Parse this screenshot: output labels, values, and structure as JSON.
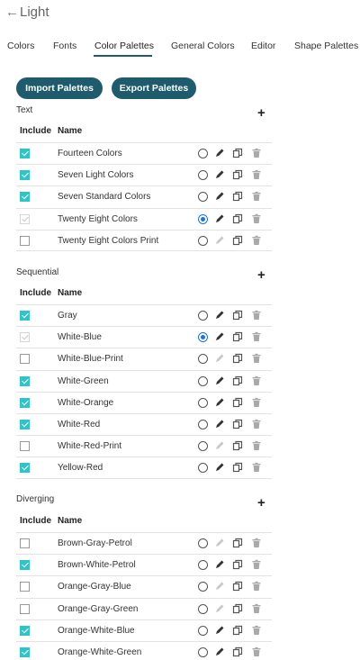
{
  "header": {
    "back_icon": "arrow-left-icon",
    "title": "Light"
  },
  "tabs": [
    {
      "label": "Colors",
      "active": false
    },
    {
      "label": "Fonts",
      "active": false
    },
    {
      "label": "Color Palettes",
      "active": true
    },
    {
      "label": "General Colors",
      "active": false
    },
    {
      "label": "Editor",
      "active": false
    },
    {
      "label": "Shape Palettes",
      "active": false
    }
  ],
  "actions": {
    "import_label": "Import Palettes",
    "export_label": "Export Palettes"
  },
  "columns": {
    "include": "Include",
    "name": "Name"
  },
  "colors": {
    "accent": "#1e5b6c",
    "check": "#2ec4c9",
    "radio": "#1b73e8"
  },
  "sections": [
    {
      "title": "Text",
      "add_icon": "plus-icon",
      "rows": [
        {
          "name": "Fourteen Colors",
          "include": "checked",
          "default": false,
          "editable": true
        },
        {
          "name": "Seven Light Colors",
          "include": "checked",
          "default": false,
          "editable": true
        },
        {
          "name": "Seven Standard Colors",
          "include": "checked",
          "default": false,
          "editable": true
        },
        {
          "name": "Twenty Eight Colors",
          "include": "disabled",
          "default": true,
          "editable": true
        },
        {
          "name": "Twenty Eight Colors Print",
          "include": "unchecked",
          "default": false,
          "editable": false
        }
      ]
    },
    {
      "title": "Sequential",
      "add_icon": "plus-icon",
      "rows": [
        {
          "name": "Gray",
          "include": "checked",
          "default": false,
          "editable": true
        },
        {
          "name": "White-Blue",
          "include": "disabled",
          "default": true,
          "editable": true
        },
        {
          "name": "White-Blue-Print",
          "include": "unchecked",
          "default": false,
          "editable": false
        },
        {
          "name": "White-Green",
          "include": "checked",
          "default": false,
          "editable": true
        },
        {
          "name": "White-Orange",
          "include": "checked",
          "default": false,
          "editable": true
        },
        {
          "name": "White-Red",
          "include": "checked",
          "default": false,
          "editable": true
        },
        {
          "name": "White-Red-Print",
          "include": "unchecked",
          "default": false,
          "editable": false
        },
        {
          "name": "Yellow-Red",
          "include": "checked",
          "default": false,
          "editable": true
        }
      ]
    },
    {
      "title": "Diverging",
      "add_icon": "plus-icon",
      "rows": [
        {
          "name": "Brown-Gray-Petrol",
          "include": "unchecked",
          "default": false,
          "editable": false
        },
        {
          "name": "Brown-White-Petrol",
          "include": "checked",
          "default": false,
          "editable": true
        },
        {
          "name": "Orange-Gray-Blue",
          "include": "unchecked",
          "default": false,
          "editable": false
        },
        {
          "name": "Orange-Gray-Green",
          "include": "unchecked",
          "default": false,
          "editable": false
        },
        {
          "name": "Orange-White-Blue",
          "include": "checked",
          "default": false,
          "editable": true
        },
        {
          "name": "Orange-White-Green",
          "include": "checked",
          "default": false,
          "editable": true
        }
      ]
    }
  ]
}
